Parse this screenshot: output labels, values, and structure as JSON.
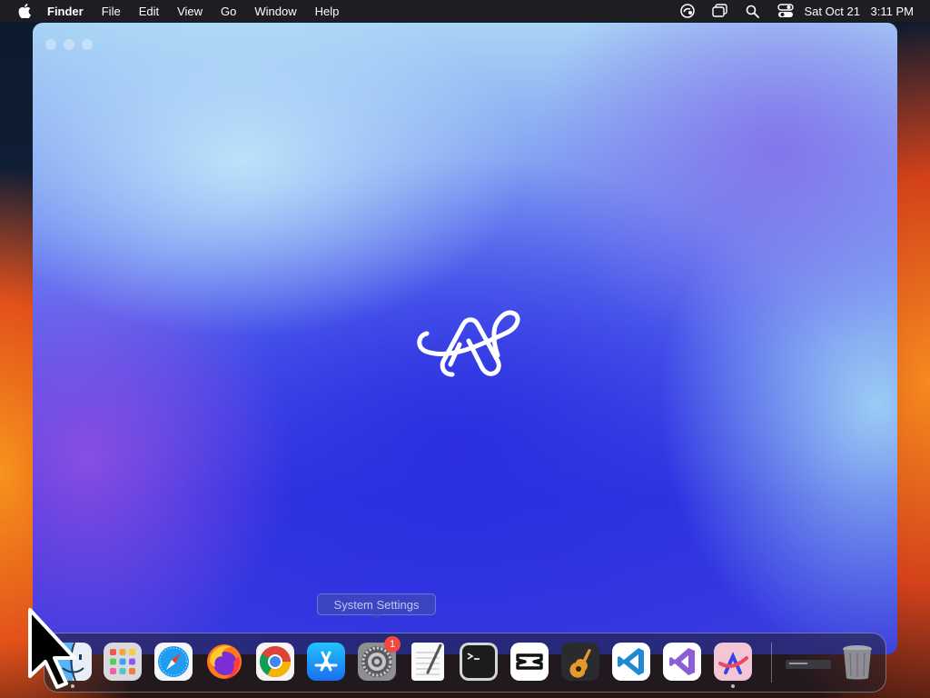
{
  "menubar": {
    "app_name": "Finder",
    "menus": [
      "File",
      "Edit",
      "View",
      "Go",
      "Window",
      "Help"
    ],
    "status_icons": [
      "screen-share-icon",
      "window-icon",
      "search-icon",
      "control-center-icon"
    ],
    "clock": {
      "date": "Sat Oct 21",
      "time": "3:11 PM"
    }
  },
  "window": {
    "app": "arc-logo-icon"
  },
  "tooltip": {
    "text": "System Settings"
  },
  "dock": {
    "items": [
      {
        "name": "finder-icon",
        "running": true
      },
      {
        "name": "launchpad-icon",
        "running": false
      },
      {
        "name": "safari-icon",
        "running": false
      },
      {
        "name": "firefox-icon",
        "running": false
      },
      {
        "name": "chrome-icon",
        "running": false
      },
      {
        "name": "app-store-icon",
        "running": false
      },
      {
        "name": "system-settings-icon",
        "running": false,
        "badge": "1"
      },
      {
        "name": "textedit-icon",
        "running": false
      },
      {
        "name": "terminal-icon",
        "running": false
      },
      {
        "name": "capcut-icon",
        "running": false
      },
      {
        "name": "garageband-icon",
        "running": false
      },
      {
        "name": "vscode-icon",
        "running": false
      },
      {
        "name": "visual-studio-icon",
        "running": false
      },
      {
        "name": "arc-icon",
        "running": true
      },
      {
        "name": "downloads-stack-icon",
        "running": false
      },
      {
        "name": "trash-icon",
        "running": false
      }
    ]
  },
  "colors": {
    "menubar": "#1e1e22",
    "badge": "#f04a3e",
    "accent": "#3136e2"
  }
}
